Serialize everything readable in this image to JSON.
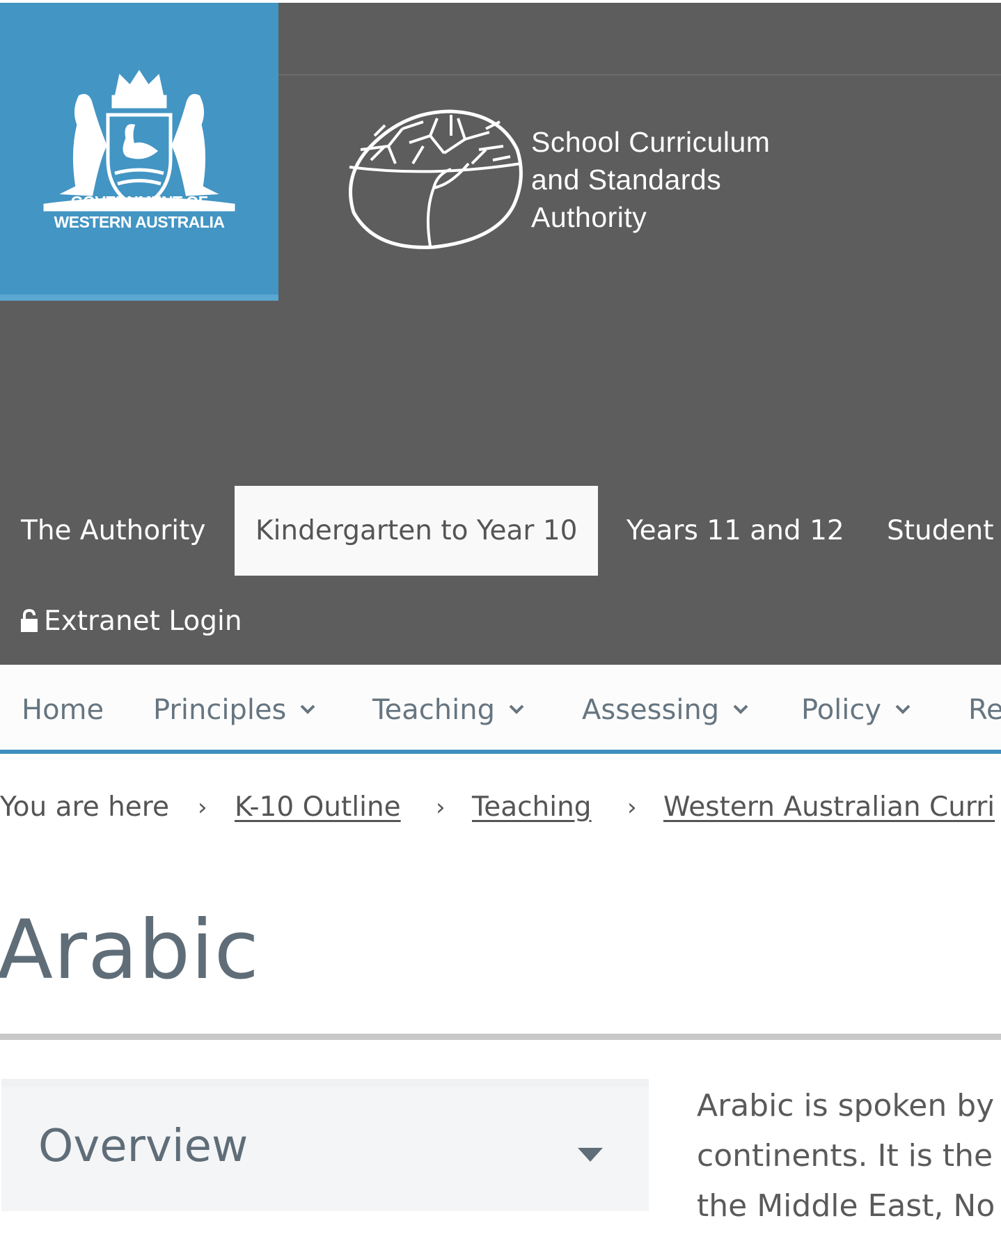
{
  "header": {
    "gov_logo": {
      "line1": "GOVERNMENT OF",
      "line2": "WESTERN AUSTRALIA"
    },
    "scsa_logo": {
      "line1": "School Curriculum",
      "line2": "and Standards",
      "line3": "Authority"
    }
  },
  "main_nav": {
    "items": [
      {
        "label": "The Authority",
        "active": false
      },
      {
        "label": "Kindergarten to Year 10",
        "active": true
      },
      {
        "label": "Years 11 and 12",
        "active": false
      },
      {
        "label": "Student",
        "active": false
      }
    ],
    "extranet_label": "Extranet Login",
    "extranet_icon": "unlock-icon"
  },
  "sub_nav": {
    "items": [
      {
        "label": "Home",
        "has_dropdown": false
      },
      {
        "label": "Principles",
        "has_dropdown": true
      },
      {
        "label": "Teaching",
        "has_dropdown": true
      },
      {
        "label": "Assessing",
        "has_dropdown": true
      },
      {
        "label": "Policy",
        "has_dropdown": true
      },
      {
        "label": "Re",
        "has_dropdown": false
      }
    ]
  },
  "breadcrumb": {
    "prefix": "You are here",
    "items": [
      "K-10 Outline ",
      "Teaching ",
      "Western Australian Curri"
    ]
  },
  "page": {
    "title": "Arabic",
    "overview_label": "Overview",
    "intro_lines": [
      "Arabic is spoken by",
      "continents. It is the",
      "the Middle East, No"
    ]
  },
  "colors": {
    "header_bg": "#5d5d5d",
    "gov_blue": "#4395c3",
    "accent_line": "#3e8ebf",
    "title": "#5f6d78"
  }
}
